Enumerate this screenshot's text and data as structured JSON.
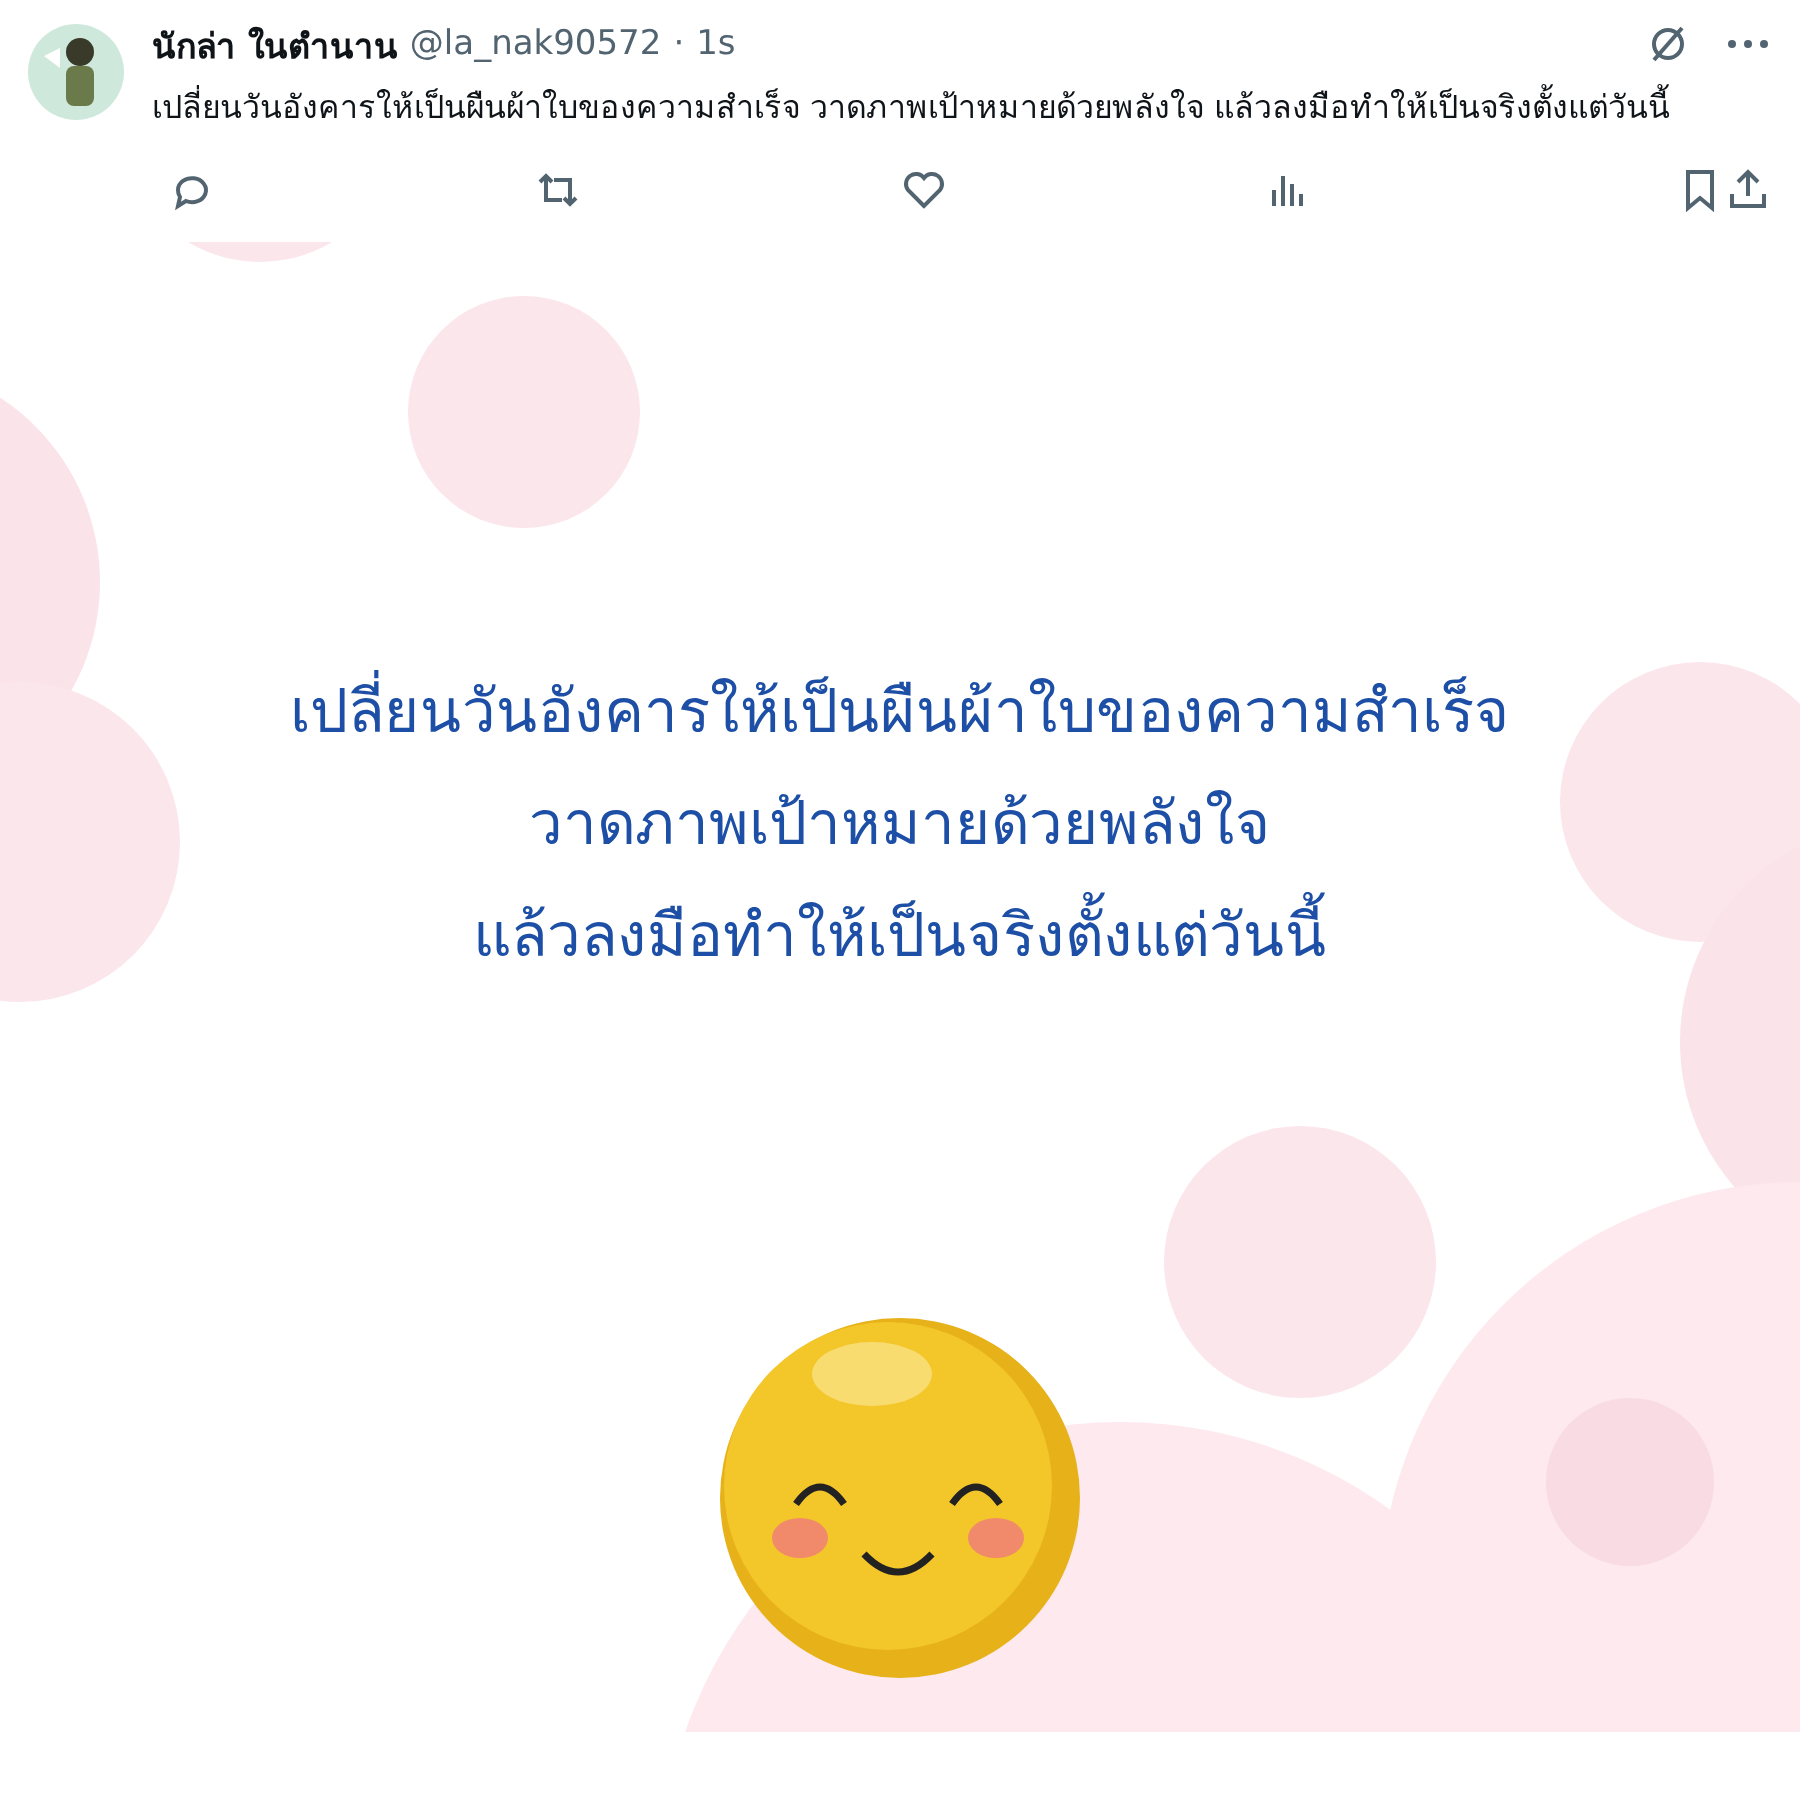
{
  "post": {
    "display_name": "นักล่า ในตำนาน",
    "handle": "@la_nak90572",
    "separator": "·",
    "time": "1s",
    "text": "เปลี่ยนวันอังคารให้เป็นผืนผ้าใบของความสำเร็จ วาดภาพเป้าหมายด้วยพลังใจ แล้วลงมือทำให้เป็นจริงตั้งแต่วันนี้"
  },
  "image": {
    "lines": [
      "เปลี่ยนวันอังคารให้เป็นผืนผ้าใบของความสำเร็จ",
      "วาดภาพเป้าหมายด้วยพลังใจ",
      "แล้วลงมือทำให้เป็นจริงตั้งแต่วันนี้"
    ]
  }
}
